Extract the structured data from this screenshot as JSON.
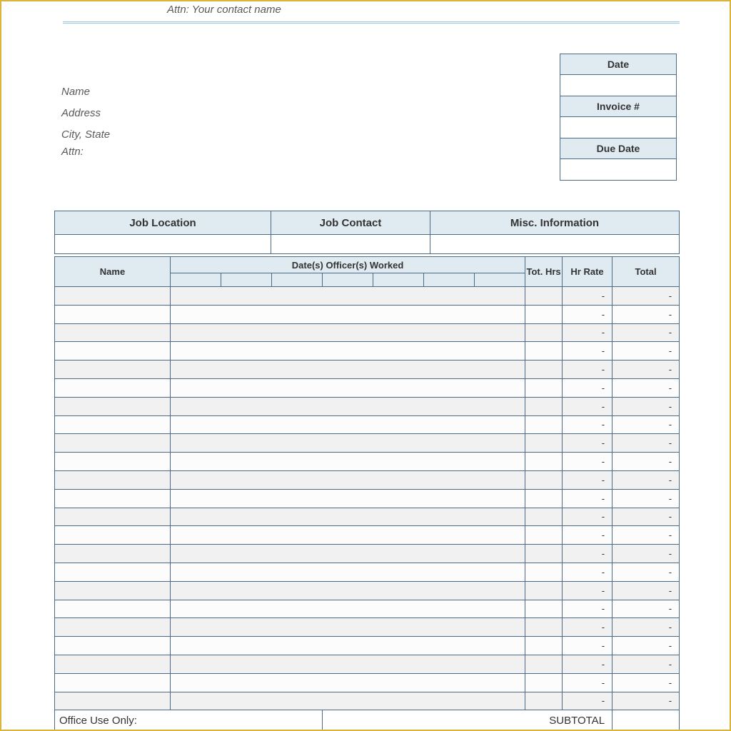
{
  "top_attn": "Attn: Your contact name",
  "bill": {
    "name": "Name",
    "address": "Address",
    "city": "City, State",
    "attn": "Attn:"
  },
  "inv": {
    "date_lbl": "Date",
    "num_lbl": "Invoice #",
    "due_lbl": "Due Date",
    "date_val": "",
    "num_val": "",
    "due_val": ""
  },
  "job": {
    "loc": "Job Location",
    "contact": "Job Contact",
    "misc": "Misc. Information"
  },
  "cols": {
    "name": "Name",
    "dates": "Date(s) Officer(s) Worked",
    "tot": "Tot. Hrs",
    "rate": "Hr Rate",
    "total": "Total"
  },
  "dash": "-",
  "footer": {
    "office": "Office Use Only:",
    "subtotal": "SUBTOTAL"
  }
}
